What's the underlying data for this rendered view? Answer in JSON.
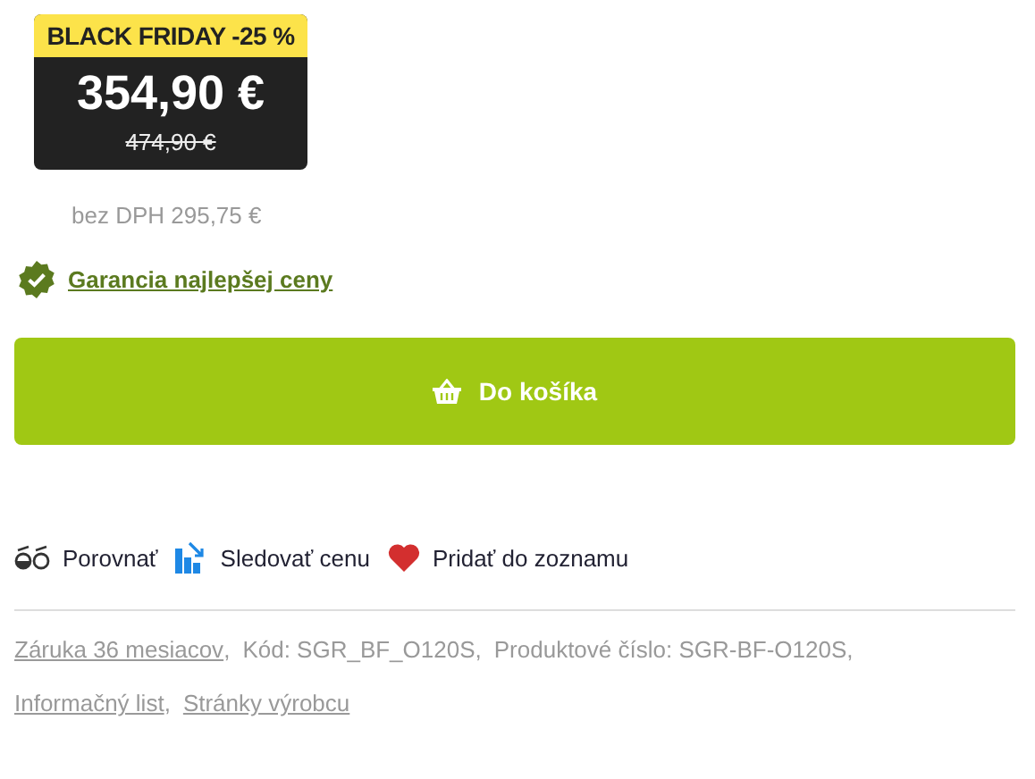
{
  "price_box": {
    "badge": "BLACK FRIDAY -25 %",
    "price": "354,90 €",
    "old_price": "474,90 €"
  },
  "price_without_vat": "bez DPH 295,75 €",
  "guarantee_link": "Garancia najlepšej ceny",
  "cart_button": "Do košíka",
  "actions": [
    {
      "kind": "compare",
      "label": "Porovnať"
    },
    {
      "kind": "watch",
      "label": "Sledovať cenu"
    },
    {
      "kind": "wishlist",
      "label": "Pridať do zoznamu"
    }
  ],
  "meta_lines": [
    [
      {
        "kind": "link",
        "text": "Záruka 36 mesiacov"
      },
      {
        "kind": "text",
        "text": ","
      },
      {
        "kind": "text",
        "text": "Kód: SGR_BF_O120S,"
      },
      {
        "kind": "text",
        "text": "Produktové číslo: SGR-BF-O120S,"
      }
    ],
    [
      {
        "kind": "link",
        "text": "Informačný list"
      },
      {
        "kind": "text",
        "text": ","
      },
      {
        "kind": "link",
        "text": "Stránky výrobcu"
      }
    ]
  ]
}
